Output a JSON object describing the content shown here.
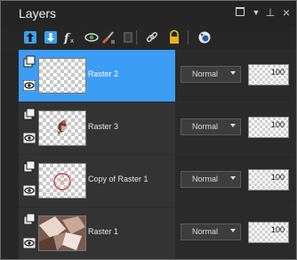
{
  "panel": {
    "title": "Layers"
  },
  "toolbar": {
    "icons": [
      "new-layer-icon",
      "merge-down-icon",
      "fx-icon",
      "visibility-icon",
      "brush-icon",
      "mask-icon",
      "link-icon",
      "lock-icon",
      "palette-icon"
    ]
  },
  "layers": [
    {
      "name": "Raster 2",
      "blend": "Normal",
      "opacity": "100",
      "selected": true
    },
    {
      "name": "Raster 3",
      "blend": "Normal",
      "opacity": "100",
      "selected": false
    },
    {
      "name": "Copy of Raster 1",
      "blend": "Normal",
      "opacity": "100",
      "selected": false
    },
    {
      "name": "Raster 1",
      "blend": "Normal",
      "opacity": "100",
      "selected": false
    }
  ],
  "colors": {
    "accent": "#3c9df5"
  }
}
